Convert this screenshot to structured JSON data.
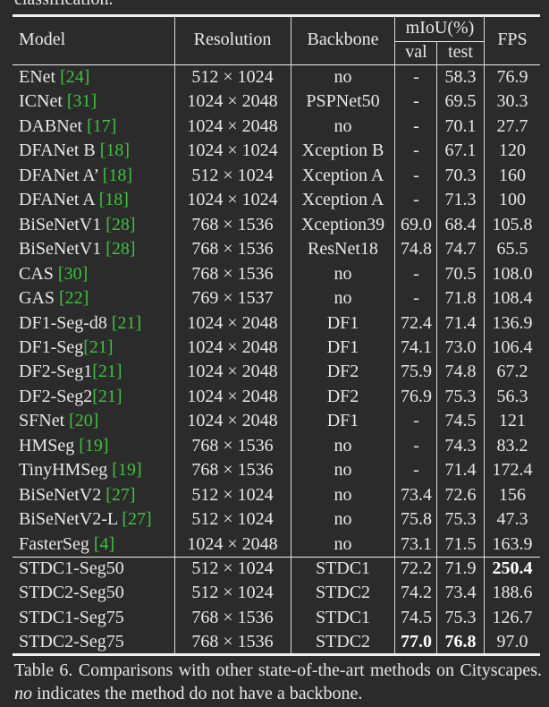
{
  "top_fragment": "classification.",
  "table": {
    "headers": {
      "model": "Model",
      "resolution": "Resolution",
      "backbone": "Backbone",
      "miou": "mIoU(%)",
      "val": "val",
      "test": "test",
      "fps": "FPS"
    },
    "rows": [
      {
        "model": "ENet",
        "ref": "24",
        "resolution": "512 × 1024",
        "backbone": "no",
        "val": "-",
        "test": "58.3",
        "fps": "76.9"
      },
      {
        "model": "ICNet",
        "ref": "31",
        "resolution": "1024 × 2048",
        "backbone": "PSPNet50",
        "val": "-",
        "test": "69.5",
        "fps": "30.3"
      },
      {
        "model": "DABNet",
        "ref": "17",
        "resolution": "1024 × 2048",
        "backbone": "no",
        "val": "-",
        "test": "70.1",
        "fps": "27.7"
      },
      {
        "model": "DFANet B",
        "ref": "18",
        "resolution": "1024 × 1024",
        "backbone": "Xception B",
        "val": "-",
        "test": "67.1",
        "fps": "120"
      },
      {
        "model": "DFANet A’",
        "ref": "18",
        "resolution": "512 × 1024",
        "backbone": "Xception A",
        "val": "-",
        "test": "70.3",
        "fps": "160"
      },
      {
        "model": "DFANet A",
        "ref": "18",
        "resolution": "1024 × 1024",
        "backbone": "Xception A",
        "val": "-",
        "test": "71.3",
        "fps": "100"
      },
      {
        "model": "BiSeNetV1",
        "ref": "28",
        "resolution": "768 × 1536",
        "backbone": "Xception39",
        "val": "69.0",
        "test": "68.4",
        "fps": "105.8"
      },
      {
        "model": "BiSeNetV1",
        "ref": "28",
        "resolution": "768 × 1536",
        "backbone": "ResNet18",
        "val": "74.8",
        "test": "74.7",
        "fps": "65.5"
      },
      {
        "model": "CAS",
        "ref": "30",
        "resolution": "768 × 1536",
        "backbone": "no",
        "val": "-",
        "test": "70.5",
        "fps": "108.0"
      },
      {
        "model": "GAS",
        "ref": "22",
        "resolution": "769 × 1537",
        "backbone": "no",
        "val": "-",
        "test": "71.8",
        "fps": "108.4"
      },
      {
        "model": "DF1-Seg-d8",
        "ref": "21",
        "resolution": "1024 × 2048",
        "backbone": "DF1",
        "val": "72.4",
        "test": "71.4",
        "fps": "136.9"
      },
      {
        "model": "DF1-Seg",
        "ref": "21",
        "resolution": "1024 × 2048",
        "backbone": "DF1",
        "val": "74.1",
        "test": "73.0",
        "fps": "106.4"
      },
      {
        "model": "DF2-Seg1",
        "ref": "21",
        "resolution": "1024 × 2048",
        "backbone": "DF2",
        "val": "75.9",
        "test": "74.8",
        "fps": "67.2"
      },
      {
        "model": "DF2-Seg2",
        "ref": "21",
        "resolution": "1024 × 2048",
        "backbone": "DF2",
        "val": "76.9",
        "test": "75.3",
        "fps": "56.3"
      },
      {
        "model": "SFNet",
        "ref": "20",
        "resolution": "1024 × 2048",
        "backbone": "DF1",
        "val": "-",
        "test": "74.5",
        "fps": "121"
      },
      {
        "model": "HMSeg",
        "ref": "19",
        "resolution": "768 × 1536",
        "backbone": "no",
        "val": "-",
        "test": "74.3",
        "fps": "83.2"
      },
      {
        "model": "TinyHMSeg",
        "ref": "19",
        "resolution": "768 × 1536",
        "backbone": "no",
        "val": "-",
        "test": "71.4",
        "fps": "172.4"
      },
      {
        "model": "BiSeNetV2",
        "ref": "27",
        "resolution": "512 × 1024",
        "backbone": "no",
        "val": "73.4",
        "test": "72.6",
        "fps": "156"
      },
      {
        "model": "BiSeNetV2-L",
        "ref": "27",
        "resolution": "512 × 1024",
        "backbone": "no",
        "val": "75.8",
        "test": "75.3",
        "fps": "47.3"
      },
      {
        "model": "FasterSeg",
        "ref": "4",
        "resolution": "1024 × 2048",
        "backbone": "no",
        "val": "73.1",
        "test": "71.5",
        "fps": "163.9"
      },
      {
        "model": "STDC1-Seg50",
        "ref": "",
        "resolution": "512 × 1024",
        "backbone": "STDC1",
        "val": "72.2",
        "test": "71.9",
        "fps": "250.4"
      },
      {
        "model": "STDC2-Seg50",
        "ref": "",
        "resolution": "512 × 1024",
        "backbone": "STDC2",
        "val": "74.2",
        "test": "73.4",
        "fps": "188.6"
      },
      {
        "model": "STDC1-Seg75",
        "ref": "",
        "resolution": "768 × 1536",
        "backbone": "STDC1",
        "val": "74.5",
        "test": "75.3",
        "fps": "126.7"
      },
      {
        "model": "STDC2-Seg75",
        "ref": "",
        "resolution": "768 × 1536",
        "backbone": "STDC2",
        "val": "77.0",
        "test": "76.8",
        "fps": "97.0"
      }
    ],
    "bold_cells": [
      {
        "row": 20,
        "col": "fps"
      },
      {
        "row": 23,
        "col": "val"
      },
      {
        "row": 23,
        "col": "test"
      }
    ]
  },
  "caption": {
    "prefix": "Table 6. Comparisons with other state-of-the-art methods on Cityscapes.",
    "emphasis": "no",
    "suffix": "indicates the method do not have a backbone."
  }
}
